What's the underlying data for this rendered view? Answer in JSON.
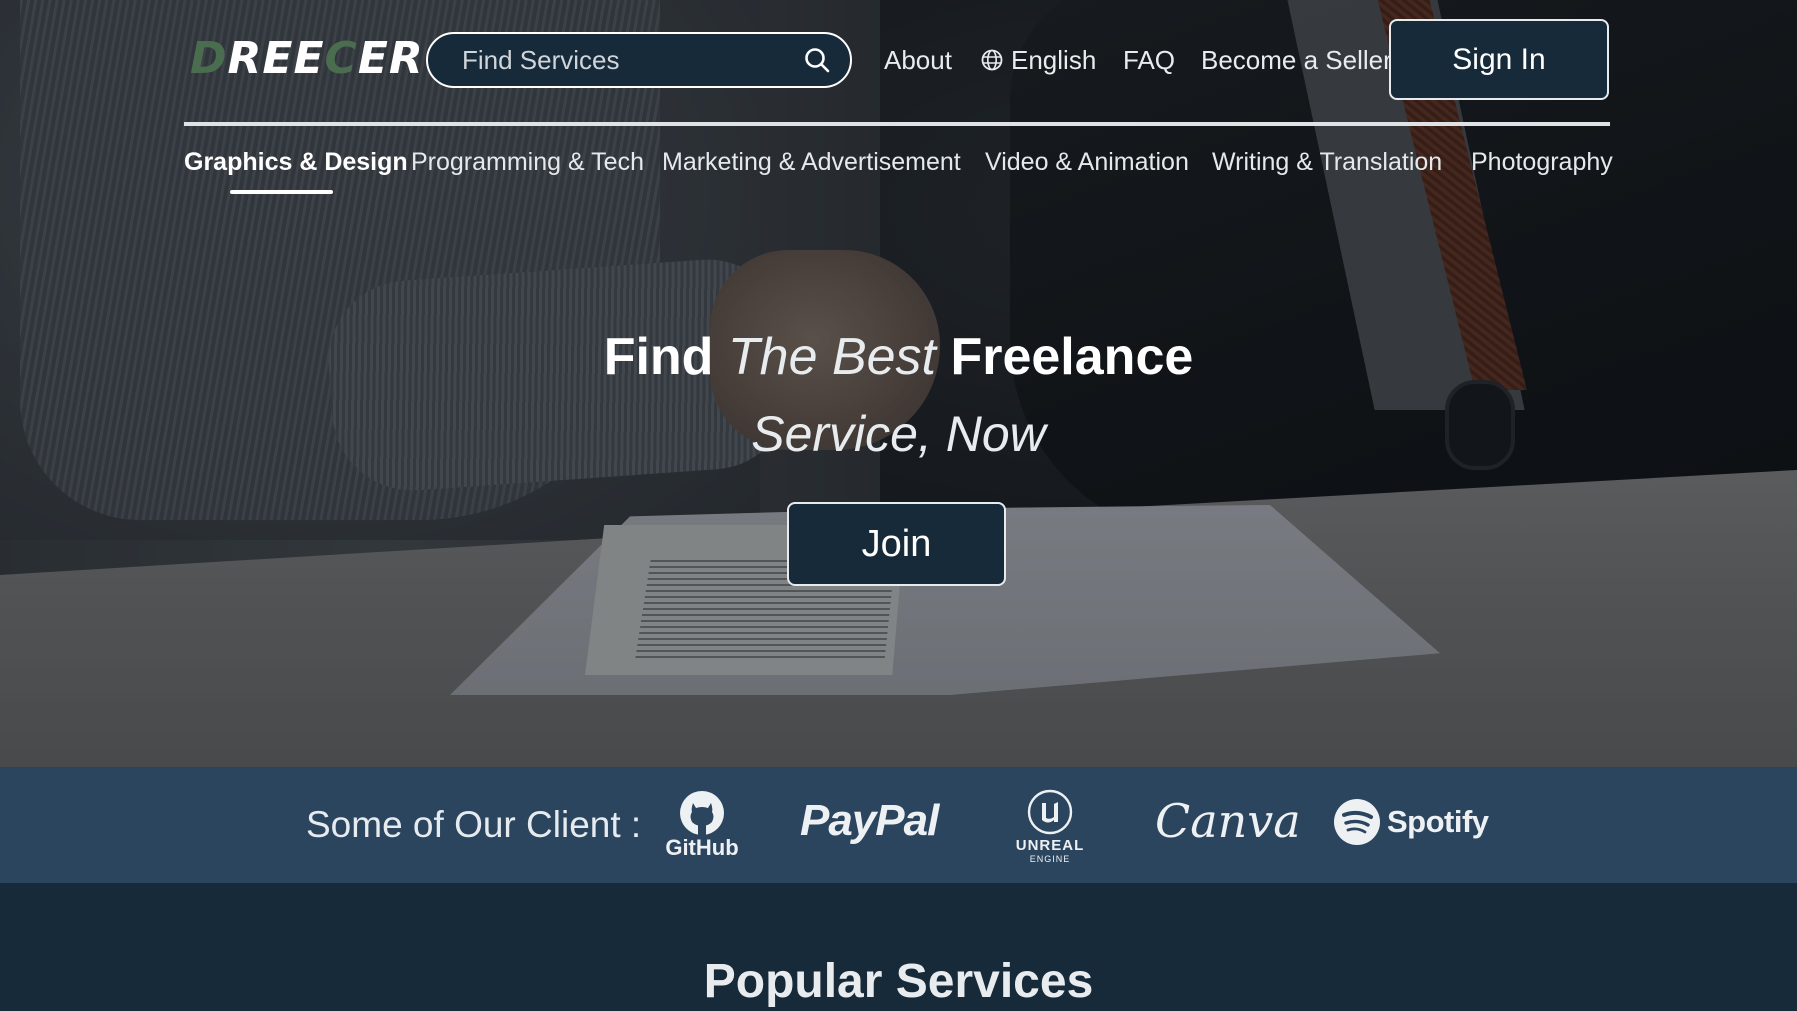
{
  "header": {
    "logo": {
      "part1": "D",
      "part2": "REE",
      "part3": "C",
      "part4": "ER"
    },
    "search": {
      "placeholder": "Find Services",
      "icon": "search-icon"
    },
    "nav": {
      "about": "About",
      "language": "English",
      "language_icon": "globe-icon",
      "faq": "FAQ",
      "become_seller": "Become a Seller"
    },
    "sign_in": "Sign In"
  },
  "categories": {
    "active_index": 0,
    "items": [
      "Graphics & Design",
      "Programming & Tech",
      "Marketing & Advertisement",
      "Video & Animation",
      "Writing & Translation",
      "Photography"
    ]
  },
  "hero": {
    "line1_a": "Find",
    "line1_b": "The Best",
    "line1_c": "Freelance",
    "line2": "Service, Now",
    "join": "Join"
  },
  "clients": {
    "label": "Some of Our Client :",
    "logos": {
      "github": "GitHub",
      "paypal": "PayPal",
      "unreal_1": "UNREAL",
      "unreal_2": "ENGINE",
      "canva": "Canva",
      "spotify": "Spotify"
    }
  },
  "sections": {
    "popular_title": "Popular Services"
  },
  "colors": {
    "navy": "#172a3a",
    "client_band": "#2c455e",
    "logo_green": "#4b6d4f",
    "text": "#ffffff"
  }
}
